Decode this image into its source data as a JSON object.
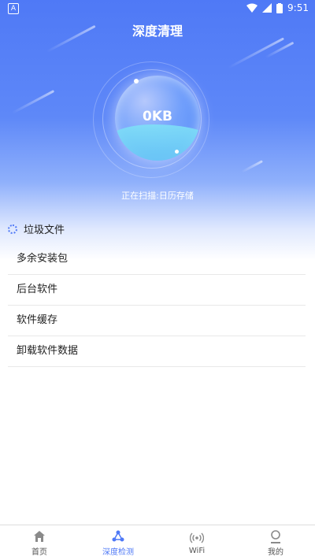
{
  "status_bar": {
    "left_icon": "A",
    "time": "9:51"
  },
  "header": {
    "title": "深度清理"
  },
  "scan": {
    "size": "0KB",
    "status": "正在扫描:日历存储"
  },
  "section": {
    "title": "垃圾文件"
  },
  "items": [
    {
      "label": "多余安装包"
    },
    {
      "label": "后台软件"
    },
    {
      "label": "软件缓存"
    },
    {
      "label": "卸载软件数据"
    }
  ],
  "tabs": [
    {
      "label": "首页",
      "icon": "home-icon"
    },
    {
      "label": "深度检测",
      "icon": "detect-icon"
    },
    {
      "label": "WiFi",
      "icon": "wifi-icon"
    },
    {
      "label": "我的",
      "icon": "profile-icon"
    }
  ],
  "colors": {
    "accent": "#4f79f6"
  }
}
